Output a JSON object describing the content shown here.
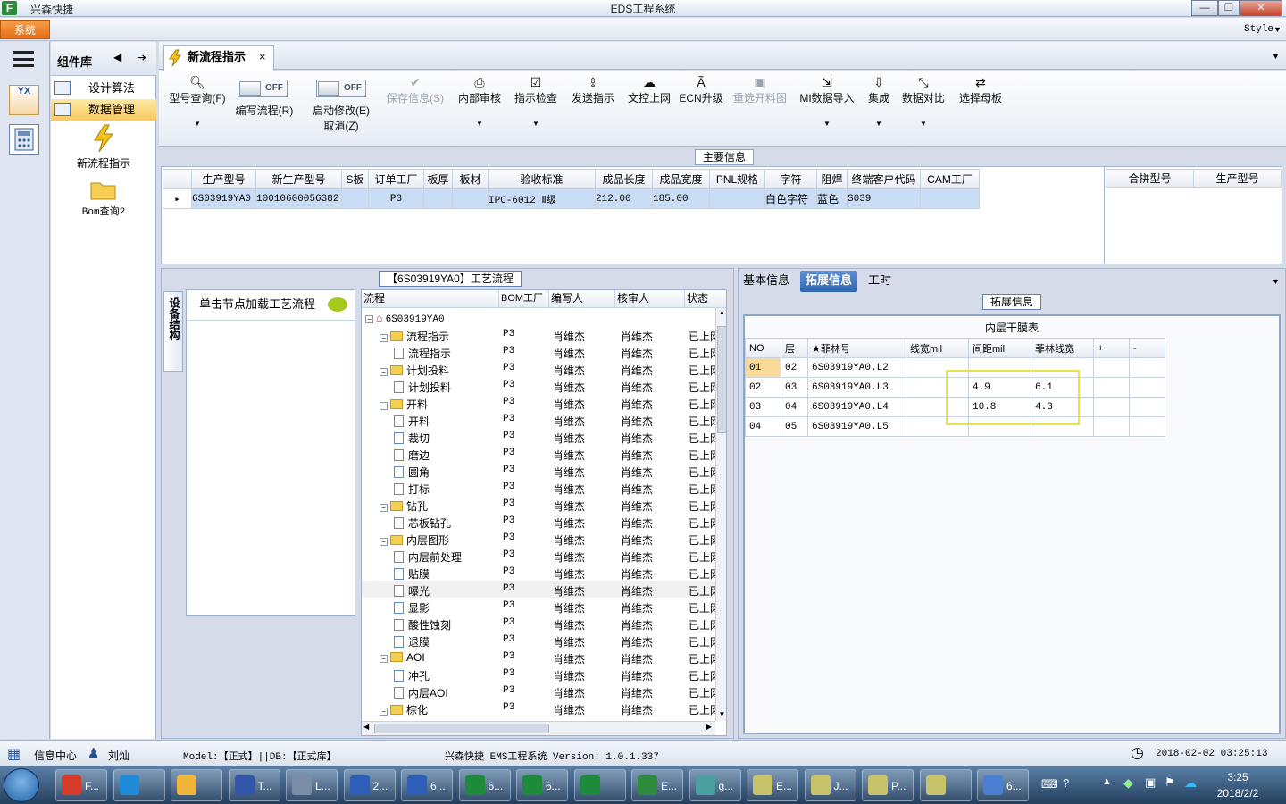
{
  "window": {
    "app_name": "兴森快捷",
    "title": "EDS工程系统",
    "min": "—",
    "max": "❐",
    "close": "✕",
    "logo_text": "F"
  },
  "menu": {
    "system": "系统",
    "style": "Style"
  },
  "leftnav": {
    "icon1_text": "YX"
  },
  "component_library": {
    "title": "组件库",
    "items": [
      {
        "label": "设计算法"
      },
      {
        "label": "数据管理"
      }
    ],
    "big_items": [
      {
        "label": "新流程指示"
      },
      {
        "label": "Bom查询2"
      }
    ]
  },
  "tabs": [
    {
      "label": "新流程指示",
      "close": "×"
    }
  ],
  "toolbar": {
    "type_query": "型号查询(F)",
    "edit_flow": "编写流程(R)",
    "start_modify": "启动修改(E)",
    "cancel": "取消(Z)",
    "toggle_off": "OFF",
    "save_info": "保存信息(S)",
    "internal_review": "内部审核",
    "indicator_check": "指示检查",
    "send_indicator": "发送指示",
    "doc_upload": "文控上网",
    "ecn_upgrade": "ECN升级",
    "reselect_cut": "重选开料图",
    "mi_import": "MI数据导入",
    "integrate": "集成",
    "data_compare": "数据对比",
    "select_master": "选择母板"
  },
  "main_info": {
    "title": "主要信息",
    "columns": [
      "生产型号",
      "新生产型号",
      "S板",
      "订单工厂",
      "板厚",
      "板材",
      "验收标准",
      "成品长度",
      "成品宽度",
      "PNL规格",
      "字符",
      "阻焊",
      "终端客户代码",
      "CAM工厂"
    ],
    "rows": [
      [
        "6S03919YA0",
        "10010600056382",
        "",
        "P3",
        "",
        "",
        "IPC-6012 Ⅱ级",
        "212.00",
        "185.00",
        "",
        "白色字符",
        "蓝色",
        "S039",
        ""
      ]
    ],
    "side_columns": [
      "合拼型号",
      "生产型号"
    ]
  },
  "process": {
    "title": "【6S03919YA0】工艺流程",
    "side_tab": "设备结构",
    "node_hint": "单击节点加载工艺流程",
    "columns": [
      "流程",
      "BOM工厂",
      "编写人",
      "核审人",
      "状态"
    ],
    "root": "6S03919YA0",
    "rows": [
      {
        "name": "流程指示",
        "level": 1,
        "type": "folder",
        "bom": "P3",
        "writer": "肖维杰",
        "reviewer": "肖维杰",
        "status": "已上网"
      },
      {
        "name": "流程指示",
        "level": 2,
        "type": "doc",
        "bom": "P3",
        "writer": "肖维杰",
        "reviewer": "肖维杰",
        "status": "已上网"
      },
      {
        "name": "计划投料",
        "level": 1,
        "type": "folder",
        "bom": "P3",
        "writer": "肖维杰",
        "reviewer": "肖维杰",
        "status": "已上网"
      },
      {
        "name": "计划投料",
        "level": 2,
        "type": "doc",
        "bom": "P3",
        "writer": "肖维杰",
        "reviewer": "肖维杰",
        "status": "已上网"
      },
      {
        "name": "开料",
        "level": 1,
        "type": "folder",
        "bom": "P3",
        "writer": "肖维杰",
        "reviewer": "肖维杰",
        "status": "已上网"
      },
      {
        "name": "开料",
        "level": 2,
        "type": "doc",
        "bom": "P3",
        "writer": "肖维杰",
        "reviewer": "肖维杰",
        "status": "已上网"
      },
      {
        "name": "裁切",
        "level": 2,
        "type": "doc",
        "bom": "P3",
        "writer": "肖维杰",
        "reviewer": "肖维杰",
        "status": "已上网"
      },
      {
        "name": "磨边",
        "level": 2,
        "type": "doc",
        "bom": "P3",
        "writer": "肖维杰",
        "reviewer": "肖维杰",
        "status": "已上网"
      },
      {
        "name": "圆角",
        "level": 2,
        "type": "doc",
        "bom": "P3",
        "writer": "肖维杰",
        "reviewer": "肖维杰",
        "status": "已上网"
      },
      {
        "name": "打标",
        "level": 2,
        "type": "doc",
        "bom": "P3",
        "writer": "肖维杰",
        "reviewer": "肖维杰",
        "status": "已上网"
      },
      {
        "name": "钻孔",
        "level": 1,
        "type": "folder",
        "bom": "P3",
        "writer": "肖维杰",
        "reviewer": "肖维杰",
        "status": "已上网"
      },
      {
        "name": "芯板钻孔",
        "level": 2,
        "type": "doc",
        "bom": "P3",
        "writer": "肖维杰",
        "reviewer": "肖维杰",
        "status": "已上网"
      },
      {
        "name": "内层图形",
        "level": 1,
        "type": "folder",
        "bom": "P3",
        "writer": "肖维杰",
        "reviewer": "肖维杰",
        "status": "已上网"
      },
      {
        "name": "内层前处理",
        "level": 2,
        "type": "doc",
        "bom": "P3",
        "writer": "肖维杰",
        "reviewer": "肖维杰",
        "status": "已上网"
      },
      {
        "name": "贴膜",
        "level": 2,
        "type": "doc",
        "bom": "P3",
        "writer": "肖维杰",
        "reviewer": "肖维杰",
        "status": "已上网"
      },
      {
        "name": "曝光",
        "level": 2,
        "type": "doc",
        "bom": "P3",
        "writer": "肖维杰",
        "reviewer": "肖维杰",
        "status": "已上网"
      },
      {
        "name": "显影",
        "level": 2,
        "type": "doc",
        "bom": "P3",
        "writer": "肖维杰",
        "reviewer": "肖维杰",
        "status": "已上网"
      },
      {
        "name": "酸性蚀刻",
        "level": 2,
        "type": "doc",
        "bom": "P3",
        "writer": "肖维杰",
        "reviewer": "肖维杰",
        "status": "已上网"
      },
      {
        "name": "退膜",
        "level": 2,
        "type": "doc",
        "bom": "P3",
        "writer": "肖维杰",
        "reviewer": "肖维杰",
        "status": "已上网"
      },
      {
        "name": "AOI",
        "level": 1,
        "type": "folder",
        "bom": "P3",
        "writer": "肖维杰",
        "reviewer": "肖维杰",
        "status": "已上网"
      },
      {
        "name": "冲孔",
        "level": 2,
        "type": "doc",
        "bom": "P3",
        "writer": "肖维杰",
        "reviewer": "肖维杰",
        "status": "已上网"
      },
      {
        "name": "内层AOI",
        "level": 2,
        "type": "doc",
        "bom": "P3",
        "writer": "肖维杰",
        "reviewer": "肖维杰",
        "status": "已上网"
      },
      {
        "name": "棕化",
        "level": 1,
        "type": "folder",
        "bom": "P3",
        "writer": "肖维杰",
        "reviewer": "肖维杰",
        "status": "已上网"
      }
    ],
    "selected_index": 15
  },
  "right_panel": {
    "tabs": [
      "基本信息",
      "拓展信息",
      "工时"
    ],
    "active_tab": 1,
    "section_title": "拓展信息",
    "table_title": "内层干膜表",
    "columns": [
      "NO",
      "层",
      "★菲林号",
      "线宽mil",
      "间距mil",
      "菲林线宽",
      "+",
      "-"
    ],
    "rows": [
      [
        "01",
        "02",
        "6S03919YA0.L2",
        "",
        "",
        "",
        "",
        ""
      ],
      [
        "02",
        "03",
        "6S03919YA0.L3",
        "",
        "4.9",
        "6.1",
        "",
        ""
      ],
      [
        "03",
        "04",
        "6S03919YA0.L4",
        "",
        "10.8",
        "4.3",
        "",
        ""
      ],
      [
        "04",
        "05",
        "6S03919YA0.L5",
        "",
        "",
        "",
        "",
        ""
      ]
    ]
  },
  "status": {
    "info_center": "信息中心",
    "user": "刘灿",
    "model": "Model:【正式】||DB:【正式库】",
    "product": "兴森快捷 EMS工程系统 Version: 1.0.1.337",
    "datetime": "2018-02-02 03:25:13"
  },
  "taskbar": {
    "tasks": [
      "F...",
      "",
      "",
      "T...",
      "L...",
      "2...",
      "6...",
      "6...",
      "6...",
      "",
      "E...",
      "g...",
      "E...",
      "J...",
      "P...",
      "",
      "6..."
    ],
    "clock_time": "3:25",
    "clock_date": "2018/2/2"
  }
}
